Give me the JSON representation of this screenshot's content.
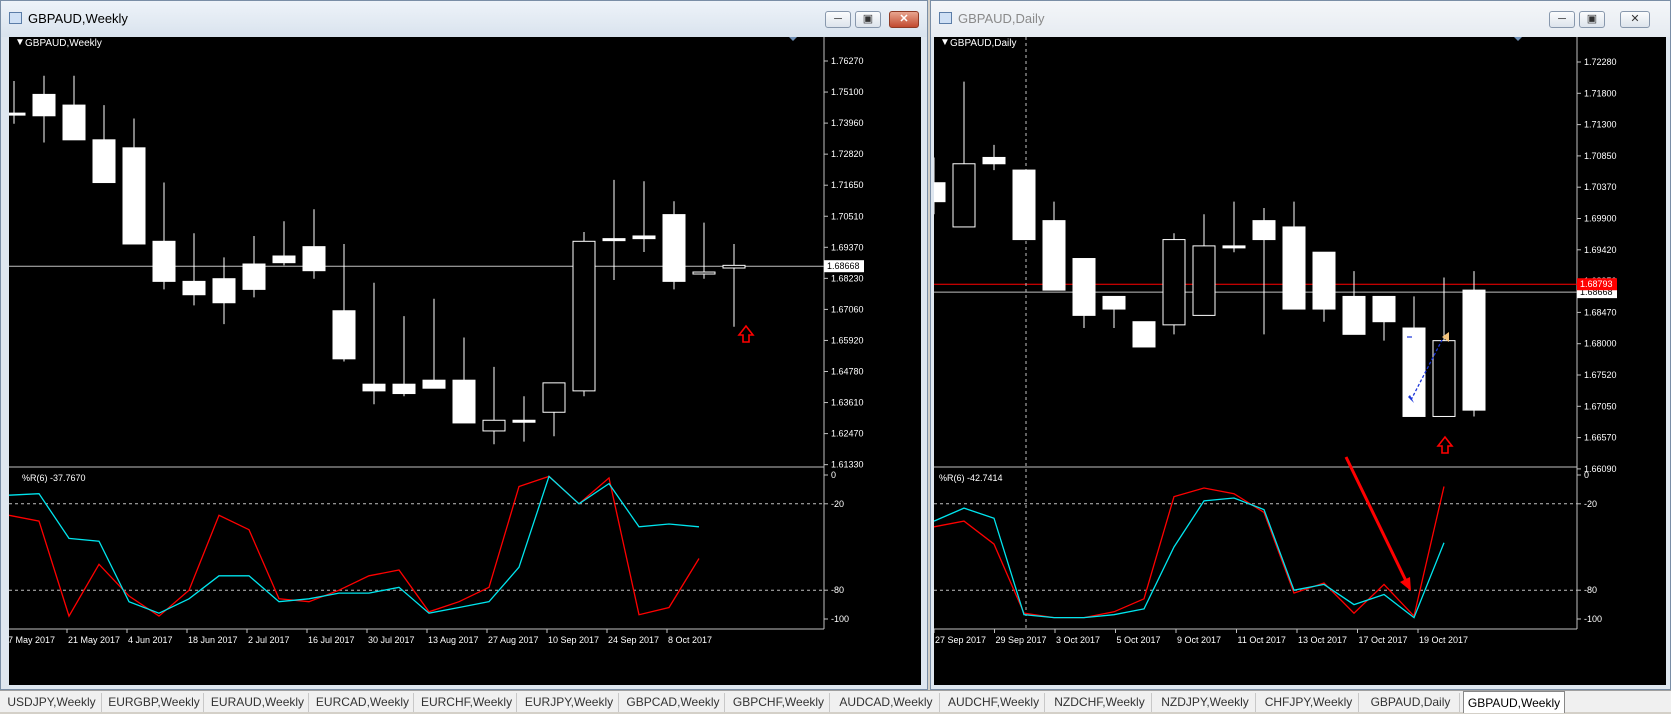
{
  "windows": [
    {
      "title": "GBPAUD,Weekly",
      "chart_label": "GBPAUD,Weekly",
      "price_ticks": [
        "1.76270",
        "1.75100",
        "1.73960",
        "1.72820",
        "1.71650",
        "1.70510",
        "1.69370",
        "1.68230",
        "1.67060",
        "1.65920",
        "1.64780",
        "1.63610",
        "1.62470",
        "1.61330"
      ],
      "current_price": "1.68668",
      "indicator_label": "%R(6) -37.7670",
      "indicator_levels": [
        "0",
        "-20",
        "-80",
        "-100"
      ],
      "date_labels": [
        "7 May 2017",
        "21 May 2017",
        "4 Jun 2017",
        "18 Jun 2017",
        "2 Jul 2017",
        "16 Jul 2017",
        "30 Jul 2017",
        "13 Aug 2017",
        "27 Aug 2017",
        "10 Sep 2017",
        "24 Sep 2017",
        "8 Oct 2017"
      ]
    },
    {
      "title": "GBPAUD,Daily",
      "chart_label": "GBPAUD,Daily",
      "price_ticks": [
        "1.72280",
        "1.71800",
        "1.71300",
        "1.70850",
        "1.70370",
        "1.69900",
        "1.69420",
        "1.68950",
        "1.68470",
        "1.68000",
        "1.67520",
        "1.67050",
        "1.66570",
        "1.66090"
      ],
      "current_price": "1.68668",
      "red_price": "1.68793",
      "indicator_label": "%R(6) -42.7414",
      "indicator_levels": [
        "0",
        "-20",
        "-80",
        "-100"
      ],
      "date_labels": [
        "27 Sep 2017",
        "29 Sep 2017",
        "3 Oct 2017",
        "5 Oct 2017",
        "9 Oct 2017",
        "11 Oct 2017",
        "13 Oct 2017",
        "17 Oct 2017",
        "19 Oct 2017"
      ]
    }
  ],
  "colors": {
    "bull": "#000000",
    "bear": "#ffffff",
    "wpr_fast": "#ff0000",
    "wpr_slow": "#00e5ee",
    "price_line": "#c0c0c0",
    "red_line": "#ff0000"
  },
  "tabs": [
    {
      "label": "USDJPY,Weekly"
    },
    {
      "label": "EURGBP,Weekly"
    },
    {
      "label": "EURAUD,Weekly"
    },
    {
      "label": "EURCAD,Weekly"
    },
    {
      "label": "EURCHF,Weekly"
    },
    {
      "label": "EURJPY,Weekly"
    },
    {
      "label": "GBPCAD,Weekly"
    },
    {
      "label": "GBPCHF,Weekly"
    },
    {
      "label": "AUDCAD,Weekly"
    },
    {
      "label": "AUDCHF,Weekly"
    },
    {
      "label": "NZDCHF,Weekly"
    },
    {
      "label": "NZDJPY,Weekly"
    },
    {
      "label": "CHFJPY,Weekly"
    },
    {
      "label": "GBPAUD,Daily"
    },
    {
      "label": "GBPAUD,Weekly"
    }
  ],
  "active_tab": "GBPAUD,Weekly",
  "chart_data": [
    {
      "type": "candlestick",
      "title": "GBPAUD,Weekly",
      "ylim": [
        1.6115,
        1.7695
      ],
      "x": [
        "30 Apr 2017",
        "7 May 2017",
        "14 May 2017",
        "21 May 2017",
        "28 May 2017",
        "4 Jun 2017",
        "11 Jun 2017",
        "18 Jun 2017",
        "25 Jun 2017",
        "2 Jul 2017",
        "9 Jul 2017",
        "16 Jul 2017",
        "23 Jul 2017",
        "30 Jul 2017",
        "6 Aug 2017",
        "13 Aug 2017",
        "20 Aug 2017",
        "27 Aug 2017",
        "3 Sep 2017",
        "10 Sep 2017",
        "17 Sep 2017",
        "24 Sep 2017",
        "1 Oct 2017",
        "8 Oct 2017",
        "15 Oct 2017"
      ],
      "open": [
        1.744,
        1.751,
        1.747,
        1.734,
        1.731,
        1.696,
        1.681,
        1.682,
        1.6875,
        1.6905,
        1.694,
        1.67,
        1.6425,
        1.6425,
        1.644,
        1.644,
        1.625,
        1.629,
        1.632,
        1.64,
        1.697,
        1.698,
        1.706,
        1.684,
        1.686
      ],
      "high": [
        1.756,
        1.758,
        1.758,
        1.747,
        1.742,
        1.718,
        1.699,
        1.69,
        1.698,
        1.7035,
        1.708,
        1.695,
        1.6805,
        1.668,
        1.6745,
        1.66,
        1.649,
        1.638,
        1.641,
        1.6995,
        1.719,
        1.7185,
        1.711,
        1.703,
        1.695
      ],
      "high_ex": [
        1.756,
        1.758,
        1.758,
        1.747,
        1.742,
        1.718,
        1.699,
        1.69,
        1.698,
        1.7035,
        1.708,
        1.695,
        1.6805,
        1.668,
        1.6745,
        1.66,
        1.649,
        1.638,
        1.641,
        1.6995,
        1.719,
        1.7185,
        1.711,
        1.703,
        1.695
      ],
      "low": [
        1.74,
        1.733,
        1.734,
        1.718,
        1.695,
        1.678,
        1.672,
        1.665,
        1.675,
        1.687,
        1.682,
        1.651,
        1.635,
        1.638,
        1.641,
        1.628,
        1.62,
        1.621,
        1.623,
        1.638,
        1.6815,
        1.692,
        1.678,
        1.682,
        1.664
      ],
      "close": [
        1.744,
        1.743,
        1.734,
        1.718,
        1.695,
        1.681,
        1.676,
        1.673,
        1.678,
        1.688,
        1.685,
        1.652,
        1.64,
        1.639,
        1.641,
        1.628,
        1.629,
        1.629,
        1.643,
        1.696,
        1.697,
        1.697,
        1.681,
        1.6845,
        1.687
      ]
    },
    {
      "type": "line",
      "title": "%R(6) -37.7670",
      "ylim": [
        -100,
        0
      ],
      "x": [
        "7 May 2017",
        "14 May 2017",
        "21 May 2017",
        "28 May 2017",
        "4 Jun 2017",
        "11 Jun 2017",
        "18 Jun 2017",
        "25 Jun 2017",
        "2 Jul 2017",
        "9 Jul 2017",
        "16 Jul 2017",
        "23 Jul 2017",
        "30 Jul 2017",
        "6 Aug 2017",
        "13 Aug 2017",
        "20 Aug 2017",
        "27 Aug 2017",
        "3 Sep 2017",
        "10 Sep 2017",
        "17 Sep 2017",
        "24 Sep 2017",
        "1 Oct 2017",
        "8 Oct 2017",
        "15 Oct 2017"
      ],
      "series": [
        {
          "values": [
            -28,
            -32,
            -98,
            -62,
            -84,
            -98,
            -80,
            -28,
            -38,
            -86,
            -88,
            -80,
            -70,
            -66,
            -95,
            -88,
            -78,
            -8,
            -1,
            -20,
            -2,
            -97,
            -92,
            -58
          ]
        },
        {
          "values": [
            -14,
            -13,
            -44,
            -46,
            -88,
            -96,
            -86,
            -70,
            -70,
            -88,
            -86,
            -82,
            -82,
            -78,
            -96,
            -92,
            -88,
            -64,
            -1,
            -20,
            -6,
            -36,
            -34,
            -36
          ]
        }
      ]
    },
    {
      "type": "candlestick",
      "title": "GBPAUD,Daily",
      "ylim": [
        1.659,
        1.7258
      ],
      "x": [
        "26 Sep 2017",
        "27 Sep 2017",
        "28 Sep 2017",
        "29 Sep 2017",
        "2 Oct 2017",
        "3 Oct 2017",
        "4 Oct 2017",
        "5 Oct 2017",
        "6 Oct 2017",
        "9 Oct 2017",
        "10 Oct 2017",
        "11 Oct 2017",
        "12 Oct 2017",
        "13 Oct 2017",
        "16 Oct 2017",
        "17 Oct 2017",
        "18 Oct 2017",
        "19 Oct 2017",
        "20 Oct 2017"
      ],
      "open": [
        1.704,
        1.697,
        1.708,
        1.706,
        1.698,
        1.692,
        1.686,
        1.682,
        1.6815,
        1.683,
        1.694,
        1.698,
        1.697,
        1.693,
        1.686,
        1.686,
        1.681,
        1.667,
        1.687
      ],
      "high": [
        1.708,
        1.72,
        1.71,
        1.706,
        1.701,
        1.69,
        1.684,
        1.681,
        1.696,
        1.699,
        1.701,
        1.7,
        1.701,
        1.69,
        1.69,
        1.683,
        1.686,
        1.689,
        1.69
      ],
      "low": [
        1.699,
        1.703,
        1.706,
        1.695,
        1.687,
        1.681,
        1.681,
        1.678,
        1.68,
        1.693,
        1.693,
        1.68,
        1.684,
        1.682,
        1.68,
        1.679,
        1.667,
        1.667,
        1.667
      ],
      "close": [
        1.701,
        1.707,
        1.707,
        1.695,
        1.687,
        1.683,
        1.684,
        1.678,
        1.695,
        1.694,
        1.694,
        1.695,
        1.684,
        1.684,
        1.68,
        1.682,
        1.667,
        1.679,
        1.668
      ]
    },
    {
      "type": "line",
      "title": "%R(6) -42.7414",
      "ylim": [
        -100,
        0
      ],
      "x": [
        "26 Sep 2017",
        "27 Sep 2017",
        "28 Sep 2017",
        "29 Sep 2017",
        "2 Oct 2017",
        "3 Oct 2017",
        "4 Oct 2017",
        "5 Oct 2017",
        "6 Oct 2017",
        "9 Oct 2017",
        "10 Oct 2017",
        "11 Oct 2017",
        "12 Oct 2017",
        "13 Oct 2017",
        "16 Oct 2017",
        "17 Oct 2017",
        "18 Oct 2017",
        "19 Oct 2017",
        "20 Oct 2017"
      ],
      "series": [
        {
          "values": [
            -36,
            -32,
            -48,
            -96,
            -99,
            -99,
            -95,
            -86,
            -15,
            -9,
            -13,
            -26,
            -82,
            -75,
            -96,
            -76,
            -98,
            -8
          ]
        },
        {
          "values": [
            -32,
            -23,
            -30,
            -97,
            -99,
            -99,
            -97,
            -93,
            -50,
            -18,
            -16,
            -24,
            -80,
            -76,
            -90,
            -83,
            -99,
            -47
          ]
        }
      ]
    }
  ]
}
